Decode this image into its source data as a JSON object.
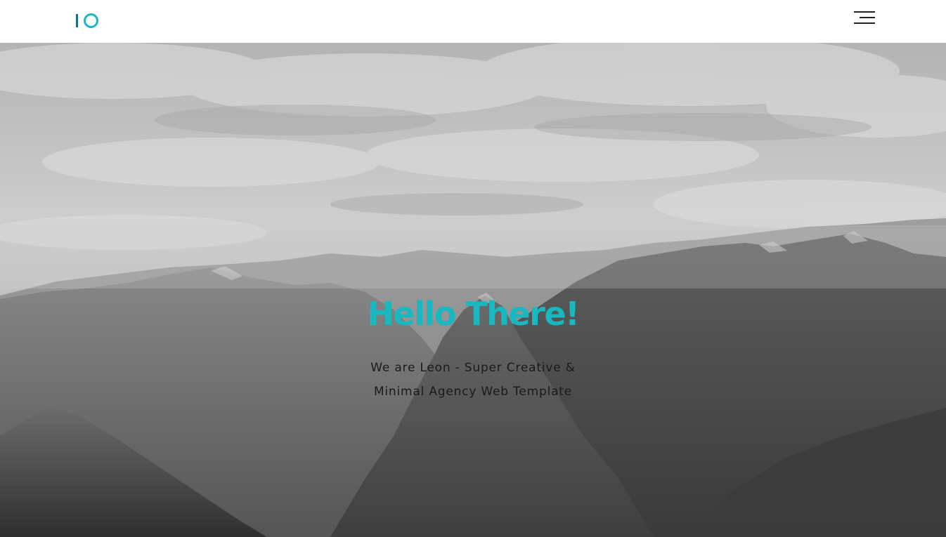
{
  "header": {
    "logo_label": "IO",
    "menu_icon": "hamburger-menu-icon"
  },
  "hero": {
    "title": "Hello There!",
    "subtitle": "We are Leon - Super Creative & Minimal Agency Web Template",
    "background": "grayscale-mountain-photo"
  },
  "colors": {
    "accent": "#17b8bf",
    "logo_dark": "#1e6f78",
    "text": "#1a1a1a",
    "header_bg": "#ffffff"
  }
}
